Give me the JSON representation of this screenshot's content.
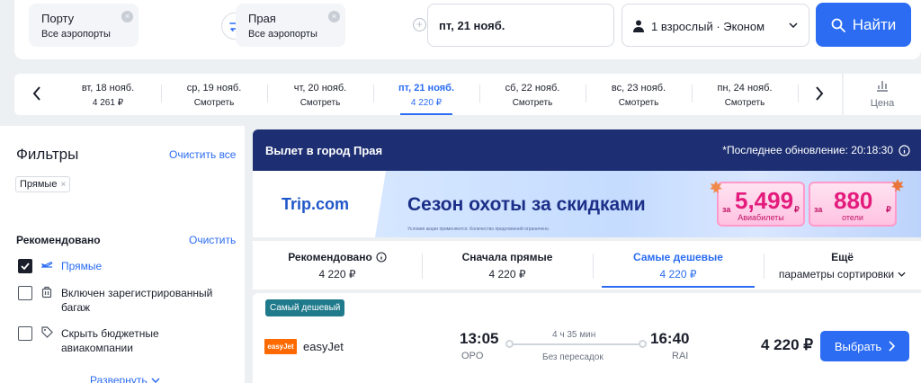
{
  "search": {
    "origin": {
      "city": "Порту",
      "airports": "Все аэропорты"
    },
    "destination": {
      "city": "Прая",
      "airports": "Все аэропорты"
    },
    "clear_glyph": "×",
    "add_glyph": "+",
    "date": "пт, 21 нояб.",
    "passengers": "1 взрослый · Эконом",
    "submit_label": "Найти"
  },
  "date_strip": {
    "days": [
      {
        "label": "вт, 18 нояб.",
        "price": "4 261 ₽",
        "active": false
      },
      {
        "label": "ср, 19 нояб.",
        "price": "Смотреть",
        "active": false
      },
      {
        "label": "чт, 20 нояб.",
        "price": "Смотреть",
        "active": false
      },
      {
        "label": "пт, 21 нояб.",
        "price": "4 220 ₽",
        "active": true
      },
      {
        "label": "сб, 22 нояб.",
        "price": "Смотреть",
        "active": false
      },
      {
        "label": "вс, 23 нояб.",
        "price": "Смотреть",
        "active": false
      },
      {
        "label": "пн, 24 нояб.",
        "price": "Смотреть",
        "active": false
      }
    ],
    "price_toggle_label": "Цена"
  },
  "filters": {
    "title": "Фильтры",
    "clear_all": "Очистить все",
    "active_chip": "Прямые",
    "chip_remove_glyph": "×",
    "section_title": "Рекомендовано",
    "section_clear": "Очистить",
    "options": [
      {
        "label": "Прямые",
        "checked": true,
        "icon": "plane-icon"
      },
      {
        "label": "Включен зарегистрированный багаж",
        "checked": false,
        "icon": "luggage-icon"
      },
      {
        "label": "Скрыть бюджетные авиакомпании",
        "checked": false,
        "icon": "tag-icon"
      }
    ],
    "expand_label": "Развернуть"
  },
  "results": {
    "title": "Вылет в город Прая",
    "updated": "*Последнее обновление: 20:18:30"
  },
  "banner": {
    "logo": "Trip.com",
    "headline": "Сезон охоты за  скидками",
    "fine_print": "Условия акции применяются. Количество предложений ограничено.",
    "ticket1": {
      "prefix": "за",
      "value": "5,499",
      "currency": "₽",
      "caption": "Авиабилеты"
    },
    "ticket2": {
      "prefix": "за",
      "value": "880",
      "currency": "₽",
      "caption": "отели"
    }
  },
  "sort": {
    "tabs": [
      {
        "label": "Рекомендовано",
        "price": "4 220 ₽",
        "active": false,
        "info": true
      },
      {
        "label": "Сначала прямые",
        "price": "4 220 ₽",
        "active": false
      },
      {
        "label": "Самые дешевые",
        "price": "4 220 ₽",
        "active": true
      },
      {
        "label": "Ещё",
        "price": "параметры сортировки",
        "active": false
      }
    ]
  },
  "flight": {
    "badge": "Самый дешевый",
    "airline_logo_text": "easyJet",
    "airline": "easyJet",
    "depart_time": "13:05",
    "depart_code": "OPO",
    "duration": "4 ч 35 мин",
    "stops": "Без пересадок",
    "arrive_time": "16:40",
    "arrive_code": "RAI",
    "price": "4 220 ₽",
    "select_label": "Выбрать"
  },
  "colors": {
    "accent": "#2b6cf2",
    "header_navy": "#1d2f72",
    "badge_teal": "#1f7a8c",
    "easyjet_orange": "#ff6a00"
  }
}
